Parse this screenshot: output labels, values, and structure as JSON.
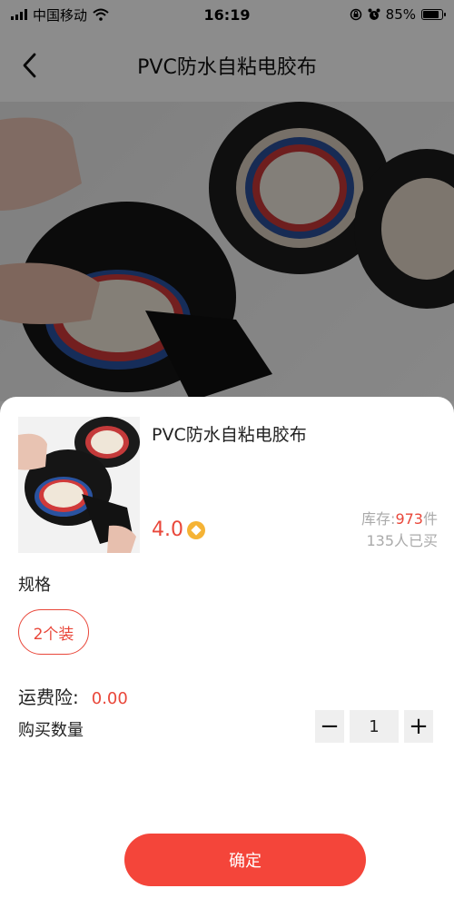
{
  "status_bar": {
    "carrier": "中国移动",
    "time": "16:19",
    "battery": "85%",
    "battery_level": 0.85,
    "icons": [
      "signal-icon",
      "wifi-icon",
      "lock-rotation-icon",
      "alarm-icon",
      "battery-icon"
    ]
  },
  "header": {
    "back_icon": "chevron-left-icon",
    "title": "PVC防水自粘电胶布"
  },
  "sheet": {
    "product_name": "PVC防水自粘电胶布",
    "price": "4.0",
    "price_icon": "coin-icon",
    "stock_label": "库存:",
    "stock_count": "973",
    "stock_unit": "件",
    "sold": "135人已买",
    "spec_label": "规格",
    "spec_option": "2个装",
    "insurance_label": "运费险:",
    "insurance_value": "0.00",
    "quantity_label": "购买数量",
    "minus": "−",
    "quantity": "1",
    "plus": "+",
    "confirm": "确定"
  },
  "colors": {
    "accent": "#e9473a",
    "button": "#f4453a",
    "coin": "#f5b335"
  }
}
